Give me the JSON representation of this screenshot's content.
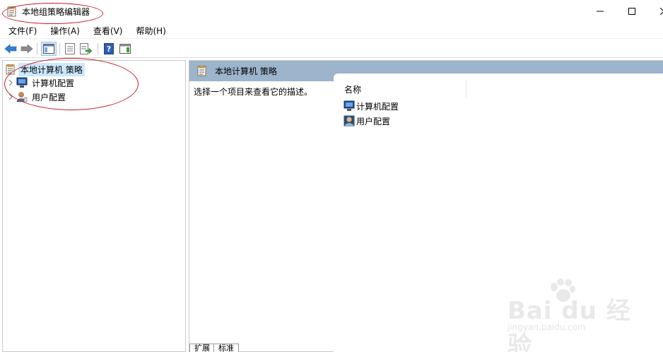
{
  "window": {
    "title": "本地组策略编辑器",
    "minimize": "—",
    "maximize": "☐",
    "close": "✕"
  },
  "menu": [
    {
      "label": "文件(F)"
    },
    {
      "label": "操作(A)"
    },
    {
      "label": "查看(V)"
    },
    {
      "label": "帮助(H)"
    }
  ],
  "tree": {
    "root": "本地计算机 策略",
    "items": [
      {
        "label": "计算机配置"
      },
      {
        "label": "用户配置"
      }
    ]
  },
  "content": {
    "header_title": "本地计算机 策略",
    "description": "选择一个项目来查看它的描述。",
    "column_name": "名称",
    "rows": [
      {
        "label": "计算机配置"
      },
      {
        "label": "用户配置"
      }
    ]
  },
  "tabs": [
    {
      "label": "扩展"
    },
    {
      "label": "标准"
    }
  ],
  "watermark": {
    "brand": "Bai du 经验",
    "url": "jingyan.baidu.com"
  },
  "colors": {
    "header_bg": "#9cb4cc",
    "selection": "#cce8ff",
    "annotation": "#c41d2c"
  }
}
